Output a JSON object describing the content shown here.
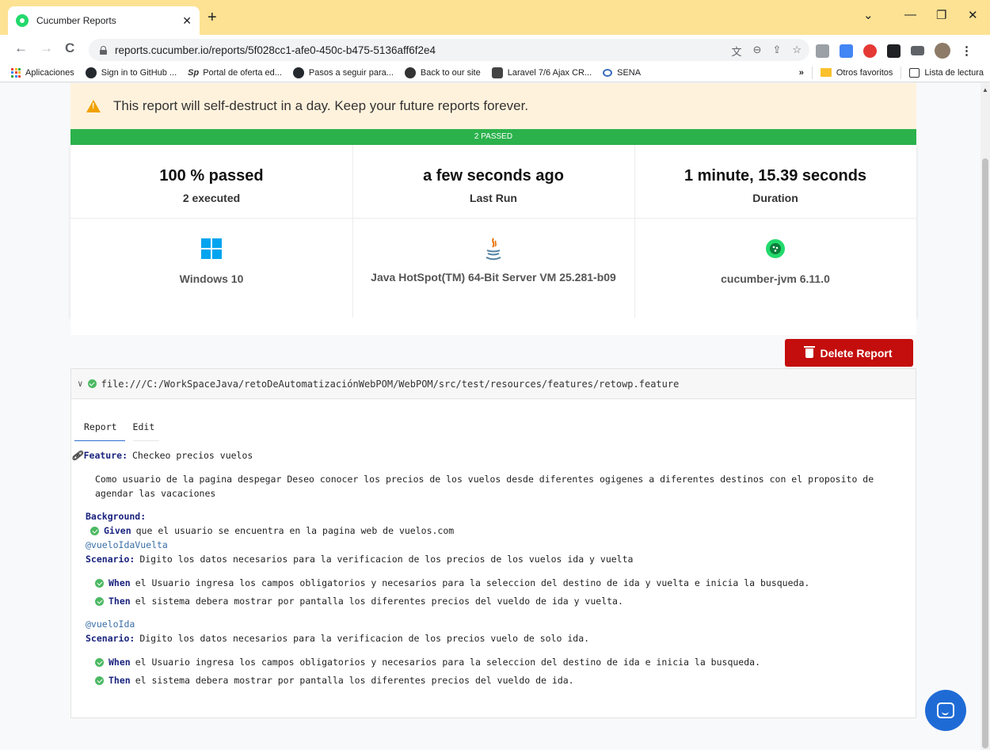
{
  "browser": {
    "tab_title": "Cucumber Reports",
    "tab_close": "✕",
    "new_tab": "+",
    "url": "reports.cucumber.io/reports/5f028cc1-afe0-450c-b475-5136aff6f2e4",
    "bookmarks": [
      {
        "label": "Aplicaciones",
        "icon": "apps-grid-icon"
      },
      {
        "label": "Sign in to GitHub ...",
        "icon": "github-icon"
      },
      {
        "label": "Portal de oferta ed...",
        "icon": "sena-portal-icon"
      },
      {
        "label": "Pasos a seguir para...",
        "icon": "github-icon"
      },
      {
        "label": "Back to our site",
        "icon": "back-site-icon"
      },
      {
        "label": "Laravel 7/6 Ajax CR...",
        "icon": "laravel-icon"
      },
      {
        "label": "SENA",
        "icon": "sena-icon"
      }
    ],
    "more_bookmarks": "»",
    "other_favorites": "Otros favoritos",
    "reading_list": "Lista de lectura"
  },
  "report": {
    "warning_text": "This report will self-destruct in a day. Keep your future reports forever.",
    "pass_bar": "2 PASSED",
    "stats": [
      {
        "value": "100 % passed",
        "label": "2 executed"
      },
      {
        "value": "a few seconds ago",
        "label": "Last Run"
      },
      {
        "value": "1 minute, 15.39 seconds",
        "label": "Duration"
      }
    ],
    "env": [
      {
        "icon": "windows-icon",
        "label": "Windows 10"
      },
      {
        "icon": "java-icon",
        "label": "Java HotSpot(TM) 64-Bit Server VM 25.281-b09"
      },
      {
        "icon": "cucumber-icon",
        "label": "cucumber-jvm 6.11.0"
      }
    ],
    "delete_label": "Delete Report",
    "feature_path": "file:///C:/WorkSpaceJava/retoDeAutomatizaciónWebPOM/WebPOM/src/test/resources/features/retowp.feature",
    "tabs": {
      "report": "Report",
      "edit": "Edit"
    },
    "feature": {
      "keyword": "Feature:",
      "name": "Checkeo precios vuelos",
      "description_1": "Como usuario de la pagina despegar Deseo conocer los precios de los vuelos desde diferentes ogigenes a diferentes destinos con el proposito de",
      "description_2": "agendar las vacaciones"
    },
    "background": {
      "keyword": "Background:",
      "step_keyword": "Given",
      "step_text": "que el usuario se encuentra en la pagina web de vuelos.com"
    },
    "scenarios": [
      {
        "tag": "@vueloIdaVuelta",
        "keyword": "Scenario:",
        "name": "Digito los datos necesarios para la verificacion de los precios de los vuelos ida y vuelta",
        "steps": [
          {
            "keyword": "When",
            "text": "el Usuario ingresa los campos obligatorios y necesarios para la seleccion del destino de ida y vuelta e inicia la busqueda."
          },
          {
            "keyword": "Then",
            "text": "el sistema debera mostrar por pantalla los diferentes precios del vueldo de ida y vuelta."
          }
        ]
      },
      {
        "tag": "@vueloIda",
        "keyword": "Scenario:",
        "name": "Digito los datos necesarios para la verificacion de los precios vuelo de solo ida.",
        "steps": [
          {
            "keyword": "When",
            "text": "el Usuario ingresa los campos obligatorios y necesarios para la seleccion del destino de ida e inicia la busqueda."
          },
          {
            "keyword": "Then",
            "text": "el sistema debera mostrar por pantalla los diferentes precios del vueldo de ida."
          }
        ]
      }
    ]
  },
  "colors": {
    "pass_green": "#2bb24c",
    "delete_red": "#c40d0d",
    "warning_bg": "#fff2dd",
    "chrome_yellow": "#fde293"
  }
}
